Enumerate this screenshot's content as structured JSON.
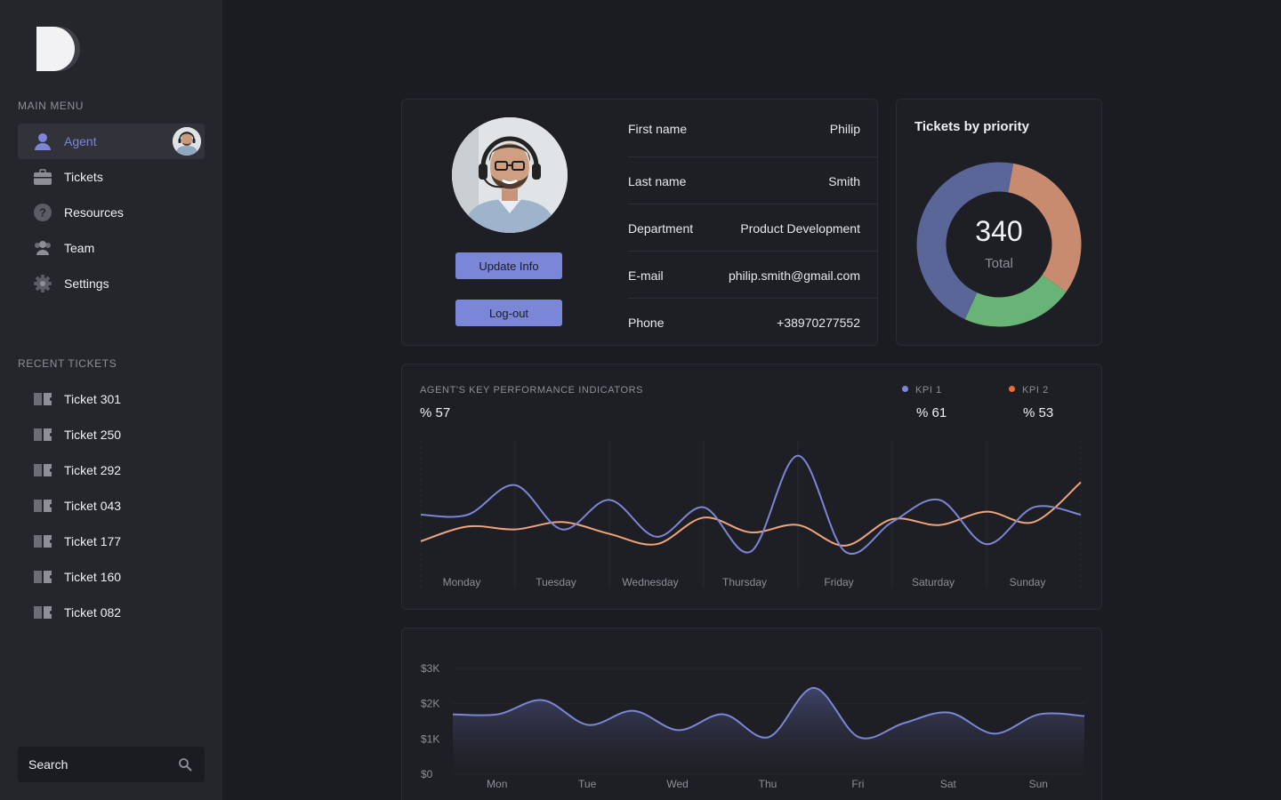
{
  "sidebar": {
    "main_menu_title": "MAIN MENU",
    "menu": [
      {
        "label": "Agent",
        "icon": "user-icon",
        "active": true
      },
      {
        "label": "Tickets",
        "icon": "briefcase-icon"
      },
      {
        "label": "Resources",
        "icon": "help-circle-icon"
      },
      {
        "label": "Team",
        "icon": "team-icon"
      },
      {
        "label": "Settings",
        "icon": "gear-icon"
      }
    ],
    "recent_title": "RECENT TICKETS",
    "recent": [
      "Ticket 301",
      "Ticket 250",
      "Ticket 292",
      "Ticket 043",
      "Ticket 177",
      "Ticket 160",
      "Ticket 082"
    ],
    "search_placeholder": "Search"
  },
  "profile": {
    "update_label": "Update Info",
    "logout_label": "Log-out",
    "fields": [
      {
        "key": "First name",
        "value": "Philip"
      },
      {
        "key": "Last name",
        "value": "Smith"
      },
      {
        "key": "Department",
        "value": "Product Development"
      },
      {
        "key": "E-mail",
        "value": "philip.smith@gmail.com"
      },
      {
        "key": "Phone",
        "value": "+38970277552"
      }
    ]
  },
  "priority": {
    "title": "Tickets by priority",
    "total": "340",
    "total_label": "Total"
  },
  "kpi": {
    "title": "AGENT'S KEY PERFORMANCE INDICATORS",
    "main_value": "% 57",
    "kpi1_label": "KPI 1",
    "kpi1_value": "% 61",
    "kpi2_label": "KPI 2",
    "kpi2_value": "% 53"
  },
  "colors": {
    "accent": "#7b86d6",
    "kpi1": "#7b86d6",
    "kpi2": "#f0a47e",
    "kpi2_dot": "#f26a2e",
    "donut_blue": "#5a6598",
    "donut_orange": "#c98b70",
    "donut_green": "#6ab376"
  },
  "chart_data": [
    {
      "type": "pie",
      "title": "Tickets by priority",
      "total": 340,
      "slices": [
        {
          "value": 0.32,
          "color": "#c98b70"
        },
        {
          "value": 0.22,
          "color": "#6ab376"
        },
        {
          "value": 0.46,
          "color": "#5a6598"
        }
      ]
    },
    {
      "type": "line",
      "categories": [
        "Monday",
        "Tuesday",
        "Wednesday",
        "Thursday",
        "Friday",
        "Saturday",
        "Sunday"
      ],
      "ylim": [
        0,
        100
      ],
      "series": [
        {
          "name": "KPI 1",
          "color": "#7b86d6",
          "x": [
            0,
            0.5,
            1,
            1.5,
            2,
            2.5,
            3,
            3.5,
            4,
            4.5,
            5,
            5.5,
            6,
            6.5,
            7
          ],
          "values": [
            50,
            50,
            70,
            40,
            60,
            35,
            55,
            25,
            90,
            25,
            45,
            60,
            30,
            55,
            50
          ]
        },
        {
          "name": "KPI 2",
          "color": "#f0a47e",
          "x": [
            0,
            0.5,
            1,
            1.5,
            2,
            2.5,
            3,
            3.5,
            4,
            4.5,
            5,
            5.5,
            6,
            6.5,
            7
          ],
          "values": [
            32,
            42,
            40,
            45,
            37,
            30,
            48,
            38,
            43,
            29,
            47,
            43,
            52,
            45,
            72
          ]
        }
      ]
    },
    {
      "type": "area",
      "categories": [
        "Mon",
        "Tue",
        "Wed",
        "Thu",
        "Fri",
        "Sat",
        "Sun"
      ],
      "yticks": [
        "$0",
        "$1K",
        "$2K",
        "$3K"
      ],
      "ylim": [
        0,
        3000
      ],
      "series": [
        {
          "color": "#7b86d6",
          "x": [
            0,
            0.5,
            1,
            1.5,
            2,
            2.5,
            3,
            3.5,
            4,
            4.5,
            5,
            5.5,
            6,
            6.5,
            7
          ],
          "values": [
            1700,
            1700,
            2100,
            1400,
            1800,
            1250,
            1700,
            1050,
            2450,
            1050,
            1450,
            1750,
            1150,
            1700,
            1650
          ]
        }
      ]
    }
  ]
}
